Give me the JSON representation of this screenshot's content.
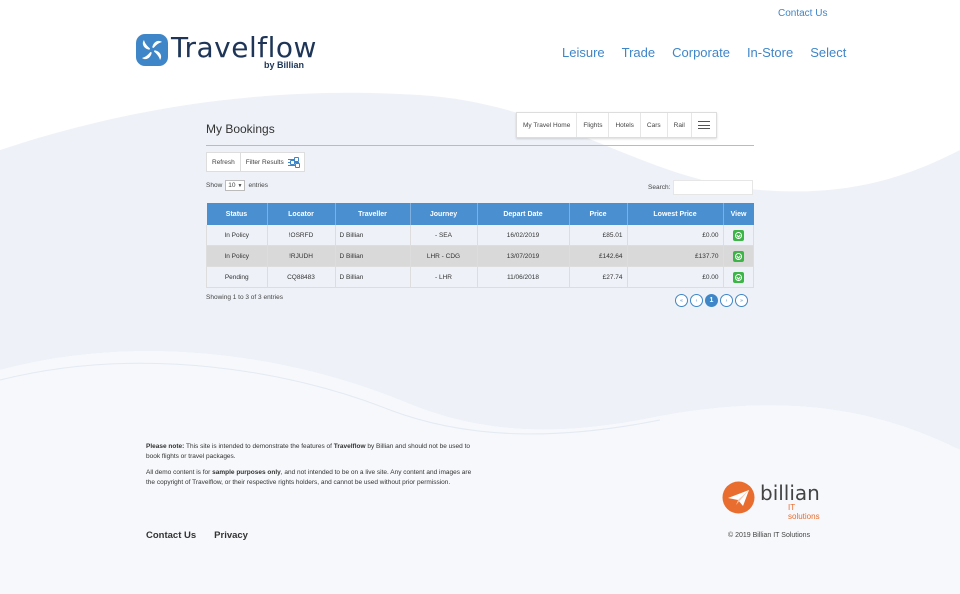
{
  "header": {
    "contact_link": "Contact Us",
    "logo_text": "Travelflow",
    "logo_sub": "by Billian",
    "nav": [
      "Leisure",
      "Trade",
      "Corporate",
      "In-Store",
      "Select"
    ]
  },
  "bookings": {
    "title": "My Bookings",
    "subnav": [
      "My Travel Home",
      "Flights",
      "Hotels",
      "Cars",
      "Rail"
    ],
    "toolbar": {
      "refresh": "Refresh",
      "filter": "Filter Results"
    },
    "length": {
      "show": "Show",
      "value": "10",
      "entries": "entries"
    },
    "search_label": "Search:",
    "columns": [
      "Status",
      "Locator",
      "Traveller",
      "Journey",
      "Depart Date",
      "Price",
      "Lowest Price",
      "View"
    ],
    "rows": [
      {
        "status": "In Policy",
        "locator": "!OSRFD",
        "traveller": "D Billian",
        "journey": "- SEA",
        "depart": "16/02/2019",
        "price": "£85.01",
        "lowest": "£0.00"
      },
      {
        "status": "In Policy",
        "locator": "!RJUDH",
        "traveller": "D Billian",
        "journey": "LHR - CDG",
        "depart": "13/07/2019",
        "price": "£142.64",
        "lowest": "£137.70"
      },
      {
        "status": "Pending",
        "locator": "CQ88483",
        "traveller": "D Billian",
        "journey": "- LHR",
        "depart": "11/06/2018",
        "price": "£27.74",
        "lowest": "£0.00"
      }
    ],
    "info": "Showing 1 to 3 of 3 entries",
    "pager": {
      "first": "«",
      "prev": "‹",
      "current": "1",
      "next": "›",
      "last": "»"
    }
  },
  "footer": {
    "note_bold": "Please note:",
    "note_1": " This site is intended to demonstrate the features of ",
    "note_brand": "Travelflow",
    "note_2": " by Billian and should not be used to book flights or travel packages.",
    "demo_1": "All demo content is for ",
    "demo_bold": "sample purposes only",
    "demo_2": ", and not intended to be on a live site. Any content and images are the copyright of Travelflow, or their respective rights holders, and cannot be used without prior permission.",
    "links": [
      "Contact Us",
      "Privacy"
    ],
    "billian_name": "billian",
    "billian_sub": "IT solutions",
    "copyright": "© 2019 Billian IT Solutions"
  },
  "colors": {
    "accent": "#3f86c8",
    "header_blue": "#4a8fd0",
    "policy_green": "#4caf50",
    "brand_orange": "#e86d2e",
    "wave": "#eef2f8"
  }
}
